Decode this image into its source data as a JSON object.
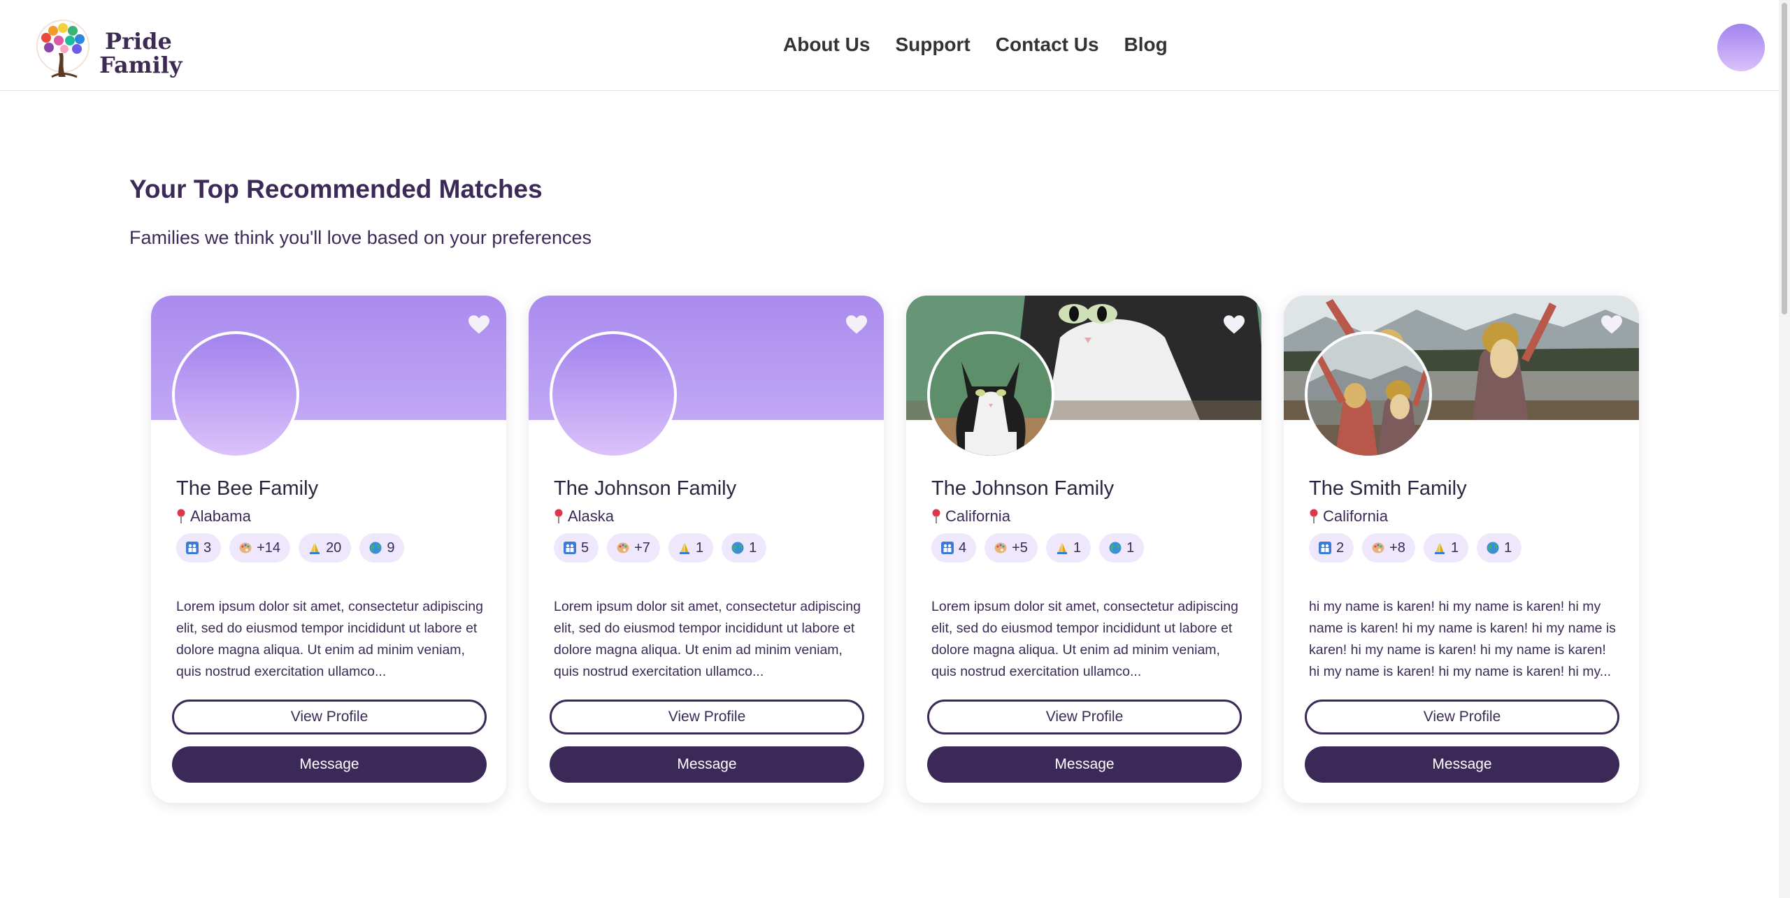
{
  "brand": {
    "line1": "Pride",
    "line2": "Family"
  },
  "nav": [
    {
      "label": "About Us"
    },
    {
      "label": "Support"
    },
    {
      "label": "Contact Us"
    },
    {
      "label": "Blog"
    }
  ],
  "section": {
    "title": "Your Top Recommended Matches",
    "subtitle": "Families we think you'll love based on your preferences"
  },
  "cards": [
    {
      "name": "The Bee Family",
      "location": "Alabama",
      "stats": {
        "members": "3",
        "kids": "+14",
        "faith": "20",
        "culture": "9"
      },
      "description": "Lorem ipsum dolor sit amet, consectetur adipiscing elit, sed do eiusmod tempor incididunt ut labore et dolore magna aliqua. Ut enim ad minim veniam, quis nostrud exercitation ullamco...",
      "view_label": "View Profile",
      "message_label": "Message"
    },
    {
      "name": "The Johnson Family",
      "location": "Alaska",
      "stats": {
        "members": "5",
        "kids": "+7",
        "faith": "1",
        "culture": "1"
      },
      "description": "Lorem ipsum dolor sit amet, consectetur adipiscing elit, sed do eiusmod tempor incididunt ut labore et dolore magna aliqua. Ut enim ad minim veniam, quis nostrud exercitation ullamco...",
      "view_label": "View Profile",
      "message_label": "Message"
    },
    {
      "name": "The Johnson Family",
      "location": "California",
      "stats": {
        "members": "4",
        "kids": "+5",
        "faith": "1",
        "culture": "1"
      },
      "description": "Lorem ipsum dolor sit amet, consectetur adipiscing elit, sed do eiusmod tempor incididunt ut labore et dolore magna aliqua. Ut enim ad minim veniam, quis nostrud exercitation ullamco...",
      "view_label": "View Profile",
      "message_label": "Message"
    },
    {
      "name": "The Smith Family",
      "location": "California",
      "stats": {
        "members": "2",
        "kids": "+8",
        "faith": "1",
        "culture": "1"
      },
      "description": "hi my name is karen! hi my name is karen! hi my name is karen! hi my name is karen! hi my name is karen! hi my name is karen! hi my name is karen! hi my name is karen! hi my name is karen! hi my...",
      "view_label": "View Profile",
      "message_label": "Message"
    }
  ],
  "colors": {
    "primary": "#3b2a58",
    "accent": "#a98bee",
    "chip": "#efe7fb"
  },
  "icons": {
    "heart": "heart-icon",
    "pin": "map-pin-icon",
    "members": "family-icon",
    "kids": "palette-icon",
    "faith": "praying-hands-icon",
    "culture": "globe-icon"
  }
}
